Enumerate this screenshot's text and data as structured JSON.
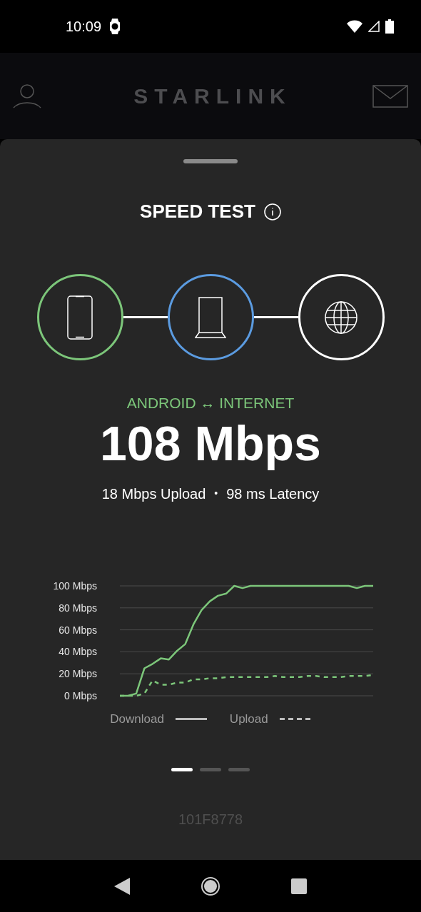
{
  "status_bar": {
    "time": "10:09"
  },
  "header": {
    "title": "STARLINK"
  },
  "sheet": {
    "title": "SPEED TEST",
    "nodes": [
      {
        "kind": "phone",
        "color": "#7cc67a"
      },
      {
        "kind": "dish",
        "color": "#5b9be0"
      },
      {
        "kind": "globe",
        "color": "#ffffff"
      }
    ],
    "route": "ANDROID ↔ INTERNET",
    "speed": "108 Mbps",
    "upload": "18 Mbps Upload",
    "separator": "•",
    "latency": "98 ms Latency",
    "chart_data": {
      "type": "line",
      "grid": true,
      "ylim": [
        0,
        100
      ],
      "yticks": [
        {
          "value": 0,
          "label": "0 Mbps"
        },
        {
          "value": 20,
          "label": "20 Mbps"
        },
        {
          "value": 40,
          "label": "40 Mbps"
        },
        {
          "value": 60,
          "label": "60 Mbps"
        },
        {
          "value": 80,
          "label": "80 Mbps"
        },
        {
          "value": 100,
          "label": "100 Mbps"
        }
      ],
      "series": [
        {
          "name": "Download",
          "color": "#7cc67a",
          "line_style": "solid",
          "values": [
            0,
            0,
            2,
            25,
            29,
            34,
            33,
            41,
            47,
            65,
            78,
            86,
            91,
            93,
            100,
            98,
            100,
            100,
            100,
            100,
            100,
            100,
            100,
            100,
            100,
            100,
            100,
            100,
            100,
            98,
            100,
            100
          ]
        },
        {
          "name": "Upload",
          "color": "#7cc67a",
          "line_style": "dashed",
          "values": [
            0,
            0,
            0,
            2,
            14,
            10,
            10,
            12,
            12,
            15,
            15,
            16,
            16,
            17,
            17,
            17,
            17,
            17,
            17,
            18,
            17,
            17,
            17,
            18,
            18,
            17,
            17,
            17,
            18,
            18,
            18,
            19
          ]
        }
      ]
    },
    "pages": [
      {
        "selected": true
      },
      {
        "selected": false
      },
      {
        "selected": false
      }
    ],
    "device_id": "101F8778"
  }
}
